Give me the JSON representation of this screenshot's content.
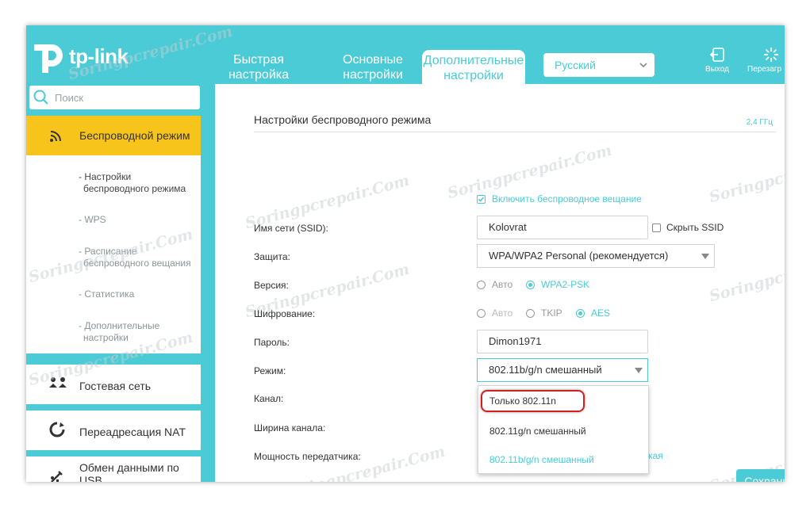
{
  "brand": {
    "logo_text": "tp-link"
  },
  "top_tabs": [
    {
      "line1": "Быстрая",
      "line2": "настройка"
    },
    {
      "line1": "Основные",
      "line2": "настройки"
    },
    {
      "line1": "Дополнительные",
      "line2": "настройки"
    }
  ],
  "header": {
    "language": "Русский",
    "logout_label": "Выход",
    "reboot_label": "Перезагр"
  },
  "sidebar": {
    "search_placeholder": "Поиск",
    "wireless_label": "Беспроводной режим",
    "sub_items": [
      {
        "line1": "- Настройки",
        "line2": "беспроводного режима"
      },
      {
        "line1": "- WPS",
        "line2": ""
      },
      {
        "line1": "- Расписание",
        "line2": "беспроводного вещания"
      },
      {
        "line1": "- Статистика",
        "line2": ""
      },
      {
        "line1": "- Дополнительные",
        "line2": "настройки"
      }
    ],
    "guest_label": "Гостевая сеть",
    "nat_label": "Переадресация NAT",
    "usb_line1": "Обмен данными по",
    "usb_line2": "USB"
  },
  "main": {
    "section_title": "Настройки беспроводного режима",
    "band": "2,4 ГГц",
    "enable_broadcast": "Включить беспроводное вещание",
    "ssid_label": "Имя сети (SSID):",
    "ssid_value": "Kolovrat",
    "hide_ssid": "Скрыть SSID",
    "security_label": "Защита:",
    "security_value": "WPA/WPA2 Personal (рекомендуется)",
    "version_label": "Версия:",
    "version_options": [
      "Авто",
      "WPA2-PSK"
    ],
    "encryption_label": "Шифрование:",
    "encryption_options": [
      "Авто",
      "TKIP",
      "AES"
    ],
    "password_label": "Пароль:",
    "password_value": "Dimon1971",
    "mode_label": "Режим:",
    "mode_value": "802.11b/g/n смешанный",
    "mode_options": [
      "Только 802.11n",
      "802.11g/n смешанный",
      "802.11b/g/n смешанный"
    ],
    "channel_label": "Канал:",
    "width_label": "Ширина канала:",
    "power_label": "Мощность передатчика:",
    "power_hidden_text": "кая",
    "save_label": "Сохранить"
  },
  "watermark": "Soringpcrepair.Com",
  "colors": {
    "accent": "#4acbd6",
    "active_nav": "#f7c41c",
    "highlight": "#d12020"
  }
}
